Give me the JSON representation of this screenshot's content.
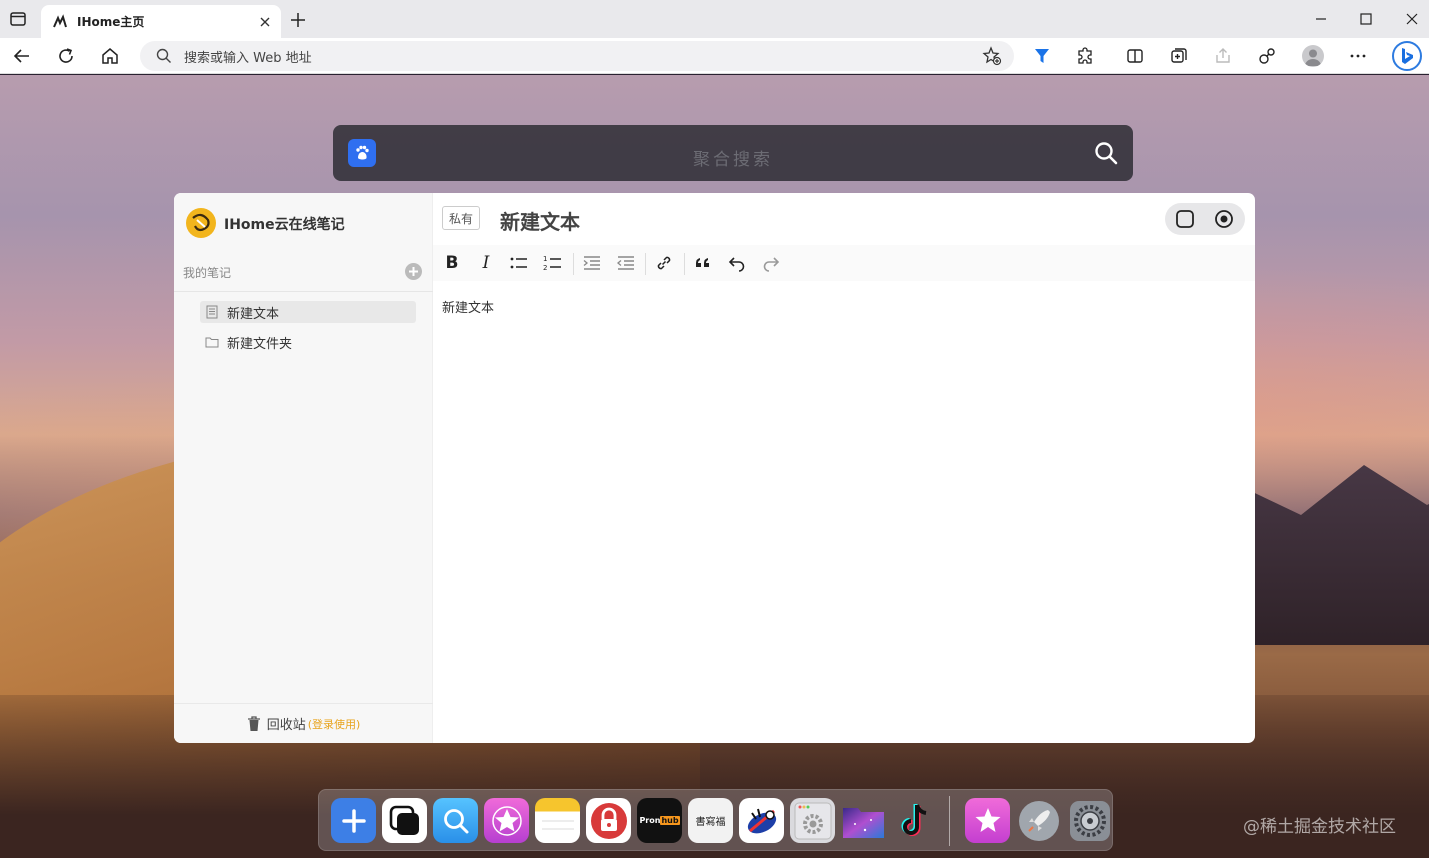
{
  "browser": {
    "tab_title": "IHome主页",
    "address_placeholder": "搜索或输入 Web 地址"
  },
  "search": {
    "placeholder": "聚合搜索"
  },
  "notes_app": {
    "title": "IHome云在线笔记",
    "section_label": "我的笔记",
    "tree": [
      {
        "label": "新建文本",
        "type": "document",
        "active": true
      },
      {
        "label": "新建文件夹",
        "type": "folder",
        "active": false
      }
    ],
    "trash_label": "回收站",
    "trash_hint": "(登录使用)",
    "privacy": "私有",
    "note_title": "新建文本",
    "note_body": "新建文本"
  },
  "dock": {
    "apps": [
      {
        "name": "add-app",
        "color": "#3d7fe6"
      },
      {
        "name": "windows-app",
        "color": "#ffffff"
      },
      {
        "name": "search-app",
        "color": "#3aa8f0"
      },
      {
        "name": "star-app",
        "color": "#d94fd6"
      },
      {
        "name": "notes-app",
        "color": "#f6c52d"
      },
      {
        "name": "lock-app",
        "color": "#d83a3a"
      },
      {
        "name": "video-app",
        "color": "#111111"
      },
      {
        "name": "calligraphy-app",
        "color": "#f0f0f0"
      },
      {
        "name": "game-app",
        "color": "#ffffff"
      },
      {
        "name": "settings-window-app",
        "color": "#d0d0d4"
      },
      {
        "name": "galaxy-folder-app",
        "color": "#6a4fb0"
      },
      {
        "name": "tiktok-app",
        "color": "#111111"
      },
      {
        "name": "itunes-star-app",
        "color": "#e04fd8"
      },
      {
        "name": "launchpad-app",
        "color": "#9aa0a8"
      },
      {
        "name": "system-preferences-app",
        "color": "#8a8f96"
      }
    ],
    "video_app_label": "Pron",
    "video_app_badge": "hub",
    "calligraphy_label": "書寫福"
  },
  "watermark": "@稀土掘金技术社区"
}
